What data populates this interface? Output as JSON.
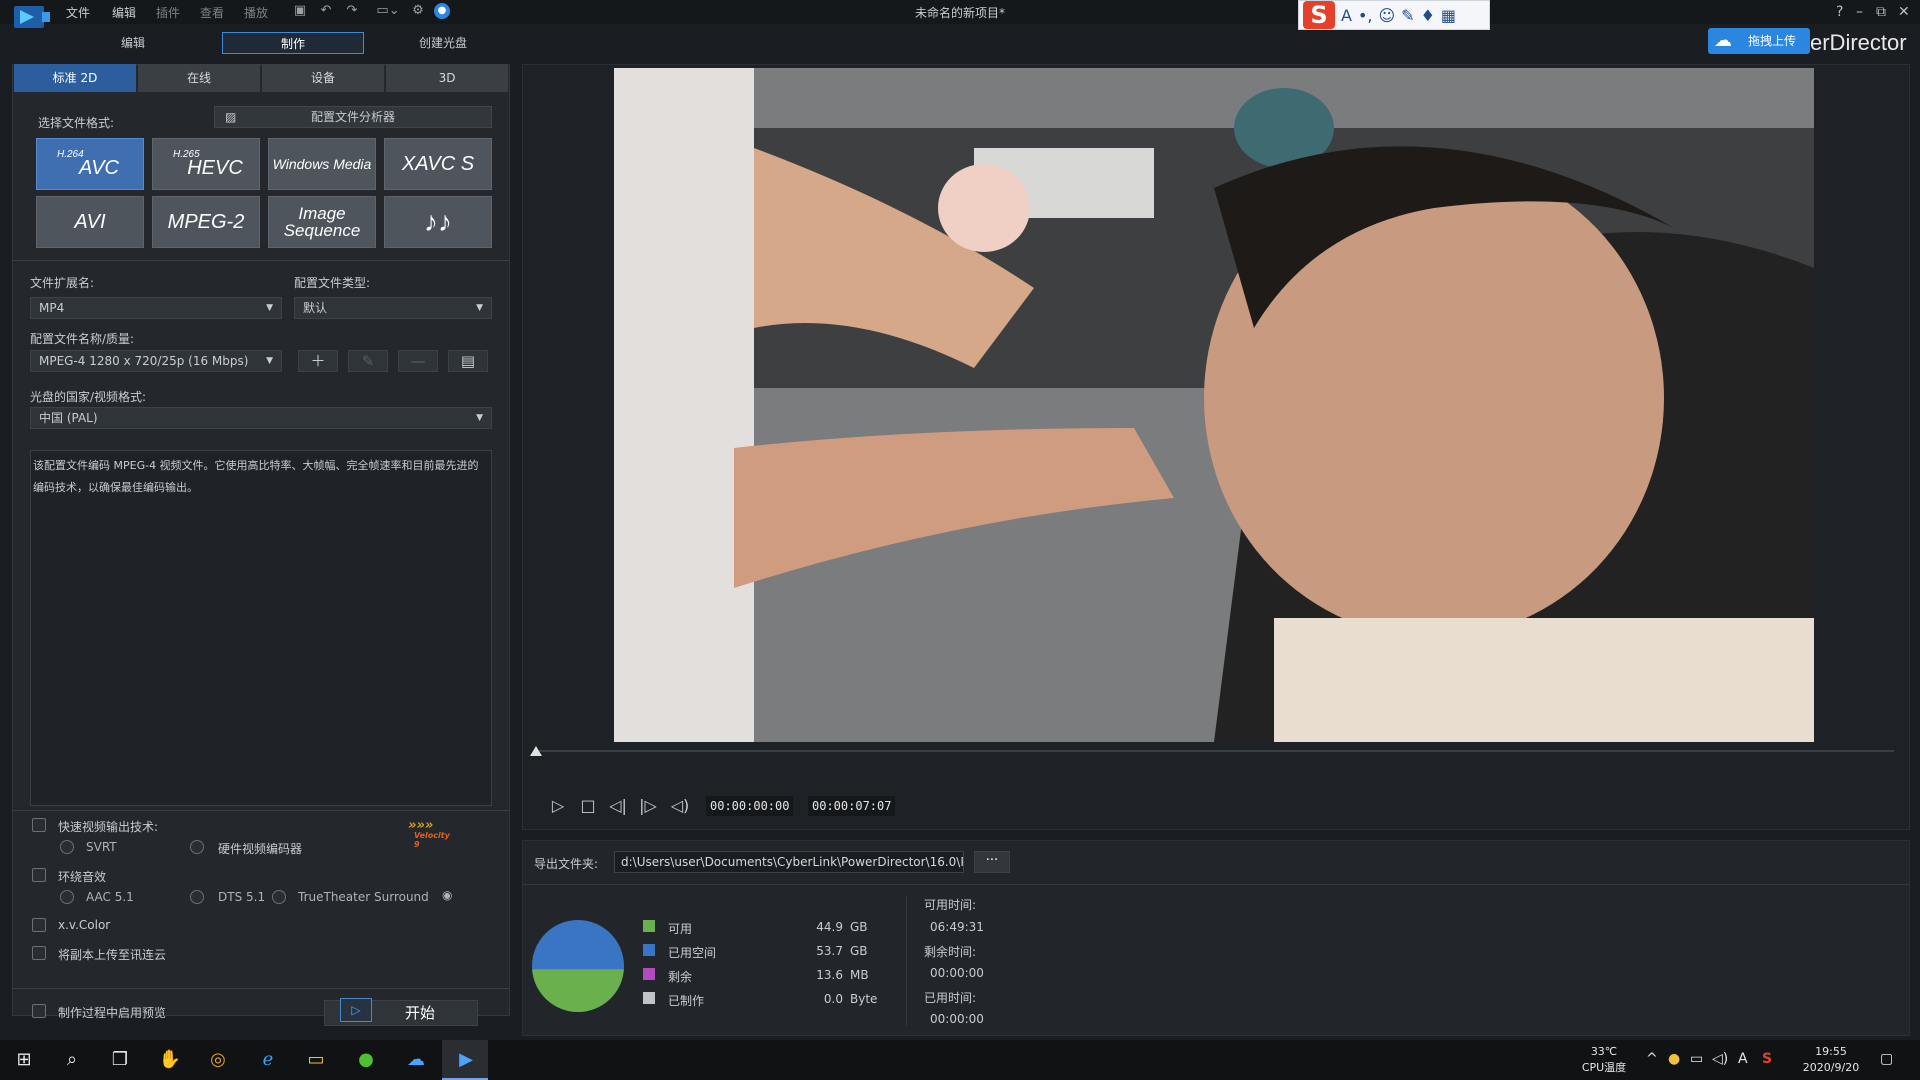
{
  "menu": [
    "文件",
    "编辑",
    "插件",
    "查看",
    "播放"
  ],
  "window_title": "未命名的新项目*",
  "brand": "erDirector",
  "cloud_upload_label": "拖拽上传",
  "modes": {
    "edit": "编辑",
    "produce": "制作",
    "disc": "创建光盘"
  },
  "sub_tabs": [
    "标准 2D",
    "在线",
    "设备",
    "3D"
  ],
  "format_section": {
    "label": "选择文件格式:",
    "analyzer_label": "配置文件分析器",
    "formats": [
      {
        "sup": "H.264",
        "name": "AVC"
      },
      {
        "sup": "H.265",
        "name": "HEVC"
      },
      {
        "sup": "",
        "name": "Windows Media"
      },
      {
        "sup": "",
        "name": "XAVC S"
      },
      {
        "sup": "",
        "name": "AVI"
      },
      {
        "sup": "",
        "name": "MPEG-2"
      },
      {
        "sup": "",
        "name": "Image Sequence"
      },
      {
        "sup": "",
        "name": "♪♪"
      }
    ]
  },
  "settings": {
    "ext_label": "文件扩展名:",
    "ext_value": "MP4",
    "profile_type_label": "配置文件类型:",
    "profile_type_value": "默认",
    "profile_name_label": "配置文件名称/质量:",
    "profile_name_value": "MPEG-4 1280 x 720/25p (16 Mbps)",
    "region_label": "光盘的国家/视频格式:",
    "region_value": "中国 (PAL)",
    "description": "该配置文件编码 MPEG-4 视频文件。它使用高比特率、大帧幅、完全帧速率和目前最先进的编码技术，以确保最佳编码输出。"
  },
  "options": {
    "fast_render": "快速视频输出技术:",
    "svrt": "SVRT",
    "hw_encoder": "硬件视频编码器",
    "velocity": "Velocity 9",
    "surround": "环绕音效",
    "aac": "AAC 5.1",
    "dts": "DTS 5.1",
    "truetheater": "TrueTheater Surround",
    "xvcolor": "x.v.Color",
    "upload_copy": "将副本上传至讯连云",
    "preview_during": "制作过程中启用预览",
    "start": "开始"
  },
  "playback": {
    "current": "00:00:00:00",
    "total": "00:00:07:07"
  },
  "output": {
    "folder_label": "导出文件夹:",
    "path": "d:\\Users\\user\\Documents\\CyberLink\\PowerDirector\\16.0\\P",
    "browse": "···",
    "legend": [
      {
        "label": "可用",
        "value": "44.9",
        "unit": "GB",
        "color": "#6ab04c"
      },
      {
        "label": "已用空间",
        "value": "53.7",
        "unit": "GB",
        "color": "#3a75c4"
      },
      {
        "label": "剩余",
        "value": "13.6",
        "unit": "MB",
        "color": "#b04cc0"
      },
      {
        "label": "已制作",
        "value": "0.0",
        "unit": "Byte",
        "color": "#c0c4c8"
      }
    ],
    "disk_fraction_available": 0.455,
    "times": [
      {
        "label": "可用时间:",
        "value": "06:49:31"
      },
      {
        "label": "剩余时间:",
        "value": "00:00:00"
      },
      {
        "label": "已用时间:",
        "value": "00:00:00"
      }
    ]
  },
  "taskbar": {
    "temp": "33℃",
    "temp_label": "CPU温度",
    "time": "19:55",
    "date": "2020/9/20"
  }
}
